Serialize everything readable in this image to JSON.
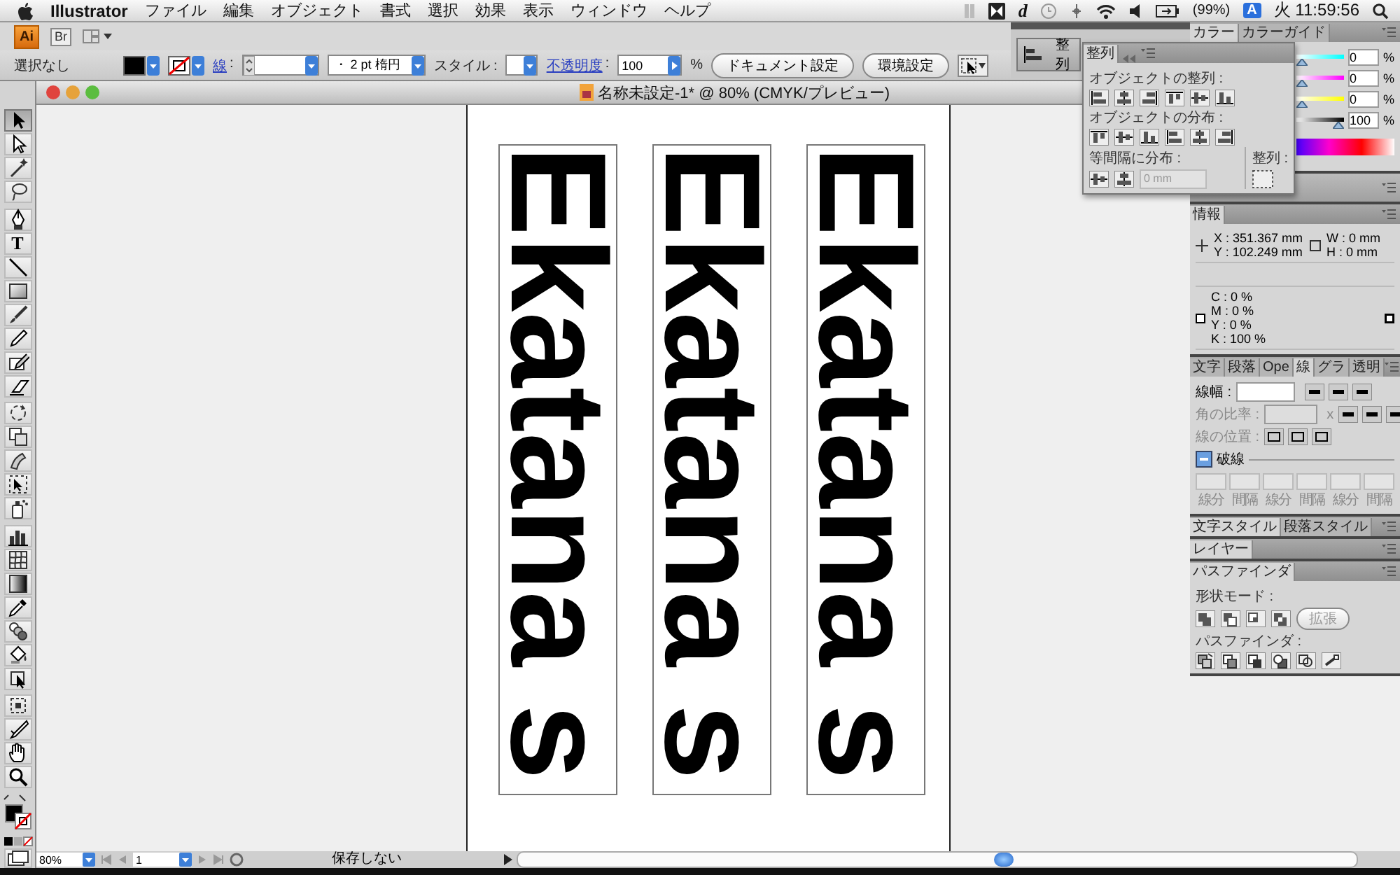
{
  "menu_bar": {
    "app_name": "Illustrator",
    "menus": [
      "ファイル",
      "編集",
      "オブジェクト",
      "書式",
      "選択",
      "効果",
      "表示",
      "ウィンドウ",
      "ヘルプ"
    ],
    "script_letter": "d",
    "battery": "(99%)",
    "input_method": "A",
    "clock": "火 11:59:56"
  },
  "app_bar": {
    "logo": "Ai",
    "bridge": "Br"
  },
  "control_bar": {
    "selection": "選択なし",
    "stroke_label": "線",
    "stroke_colon": ":",
    "brush": "・  2 pt 楕円",
    "style_label": "スタイル :",
    "opacity_label": "不透明度",
    "opacity_colon": ":",
    "opacity": "100",
    "opacity_unit": "%",
    "buttons": [
      "ドキュメント設定",
      "環境設定"
    ]
  },
  "tools": [
    {
      "kind": "select",
      "selected": true
    },
    {
      "kind": "direct-select",
      "selected": false
    },
    {
      "kind": "wand",
      "selected": false
    },
    {
      "kind": "lasso",
      "selected": false
    },
    {
      "kind": "pen",
      "selected": false
    },
    {
      "kind": "type",
      "glyph": "T",
      "selected": false
    },
    {
      "kind": "line",
      "selected": false
    },
    {
      "kind": "rectangle",
      "selected": false
    },
    {
      "kind": "brush",
      "selected": false
    },
    {
      "kind": "pencil",
      "selected": false
    },
    {
      "kind": "blob",
      "selected": false
    },
    {
      "kind": "eraser",
      "selected": false
    },
    {
      "kind": "rotate",
      "selected": false
    },
    {
      "kind": "scale",
      "selected": false
    },
    {
      "kind": "warp",
      "selected": false
    },
    {
      "kind": "transform",
      "selected": false
    },
    {
      "kind": "spray",
      "selected": false
    },
    {
      "kind": "graph",
      "selected": false
    },
    {
      "kind": "mesh",
      "selected": false
    },
    {
      "kind": "gradient",
      "selected": false
    },
    {
      "kind": "eyedropper",
      "selected": false
    },
    {
      "kind": "blend",
      "selected": false
    },
    {
      "kind": "bucket",
      "selected": false
    },
    {
      "kind": "paint-select",
      "selected": false
    },
    {
      "kind": "crop",
      "selected": false
    },
    {
      "kind": "knife",
      "selected": false
    },
    {
      "kind": "hand",
      "selected": false
    },
    {
      "kind": "zoom",
      "selected": false
    }
  ],
  "document": {
    "title": "名称未設定-1* @ 80% (CMYK/プレビュー)",
    "text_frames": [
      "Ekatana s",
      "Ekatana s",
      "Ekatana s"
    ]
  },
  "status_bar": {
    "zoom": "80%",
    "page": "1",
    "save_state": "保存しない"
  },
  "dock": {
    "collapsed_button": "整列"
  },
  "align_panel": {
    "tab": "整列",
    "align_label": "オブジェクトの整列 :",
    "align_buttons": [
      {
        "kind": "left"
      },
      {
        "kind": "hcenter"
      },
      {
        "kind": "right"
      },
      {
        "kind": "top"
      },
      {
        "kind": "vcenter"
      },
      {
        "kind": "bottom"
      }
    ],
    "distribute_label": "オブジェクトの分布 :",
    "distribute_buttons": [
      {
        "kind": "top"
      },
      {
        "kind": "vcenter"
      },
      {
        "kind": "bottom"
      },
      {
        "kind": "left"
      },
      {
        "kind": "hcenter"
      },
      {
        "kind": "right"
      }
    ],
    "spacing_label": "等間隔に分布 :",
    "spacing_value": "0 mm",
    "align_to_label": "整列 :"
  },
  "color_panel": {
    "tabs": [
      {
        "label": "カラー",
        "selected": true
      },
      {
        "label": "カラーガイド",
        "selected": false
      }
    ],
    "channels": [
      {
        "value": "0",
        "unit": "%",
        "level": 0
      },
      {
        "value": "0",
        "unit": "%",
        "level": 0
      },
      {
        "value": "0",
        "unit": "%",
        "level": 0
      },
      {
        "value": "100",
        "unit": "%",
        "level": 1
      }
    ]
  },
  "info_panel": {
    "tab": "情報",
    "position": [
      "X : 351.367 mm",
      "Y : 102.249 mm"
    ],
    "size": [
      "W : 0 mm",
      "H : 0 mm"
    ],
    "cmyk": [
      "C : 0 %",
      "M : 0 %",
      "Y : 0 %",
      "K : 100 %"
    ]
  },
  "stroke_panel": {
    "tabs": [
      {
        "label": "文字",
        "selected": false
      },
      {
        "label": "段落",
        "selected": false
      },
      {
        "label": "Ope",
        "selected": false
      },
      {
        "label": "線",
        "selected": true
      },
      {
        "label": "グラ",
        "selected": false
      },
      {
        "label": "透明",
        "selected": false
      }
    ],
    "weight_label": "線幅 :",
    "miter_label": "角の比率 :",
    "miter_unit": "x",
    "align_label": "線の位置 :",
    "dashed": {
      "label": "破線",
      "expanded": true
    },
    "dash_fields": [
      "線分",
      "間隔",
      "線分",
      "間隔",
      "線分",
      "間隔"
    ]
  },
  "style_panel": {
    "tabs": [
      {
        "label": "文字スタイル",
        "selected": true
      },
      {
        "label": "段落スタイル",
        "selected": false
      }
    ]
  },
  "layers_panel": {
    "tab": "レイヤー"
  },
  "pathfinder_panel": {
    "tab": "パスファインダ",
    "shape_modes_label": "形状モード :",
    "shape_modes": [
      {
        "kind": "unite"
      },
      {
        "kind": "minus"
      },
      {
        "kind": "intersect"
      },
      {
        "kind": "exclude"
      }
    ],
    "expand_button": "拡張",
    "pathfinders_label": "パスファインダ :",
    "pathfinders": [
      {
        "kind": "divide"
      },
      {
        "kind": "trim"
      },
      {
        "kind": "merge"
      },
      {
        "kind": "crop"
      },
      {
        "kind": "outline"
      },
      {
        "kind": "minus-back"
      }
    ]
  }
}
